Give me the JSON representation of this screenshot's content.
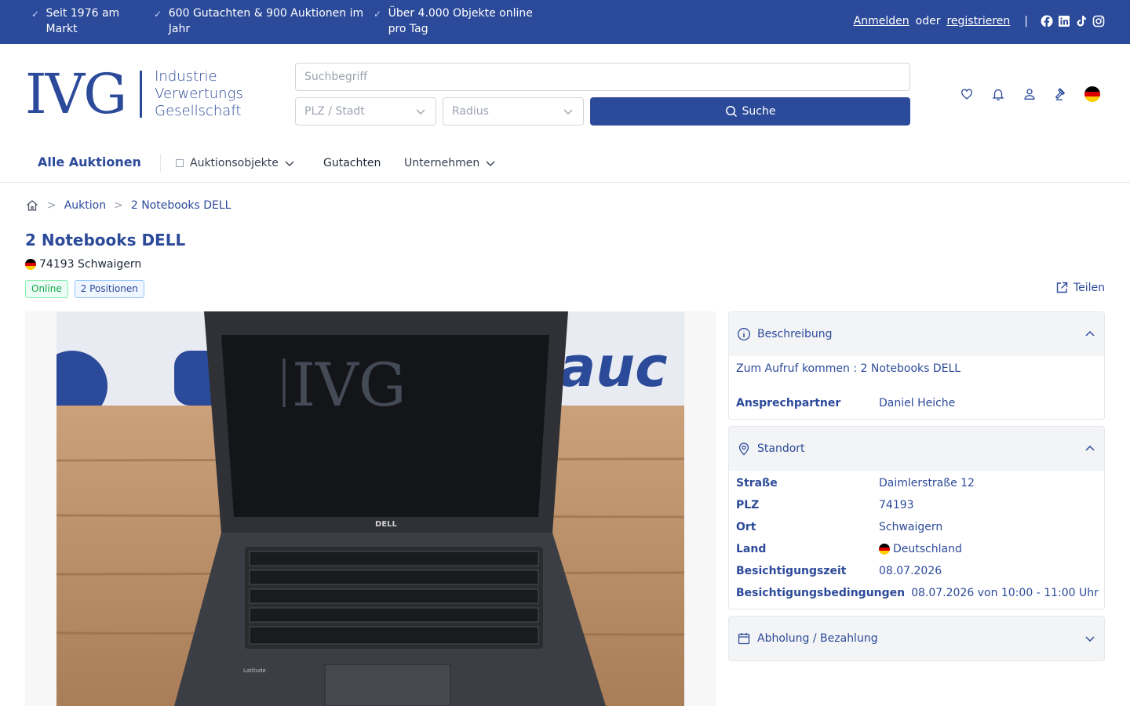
{
  "topbar": {
    "usps": [
      {
        "text": "Seit 1976 am Markt"
      },
      {
        "text": "600 Gutachten & 900 Auktionen im Jahr"
      },
      {
        "text": "Über 4.000 Objekte online pro Tag"
      }
    ],
    "login_label": "Anmelden",
    "or_label": "oder",
    "register_label": "registrieren",
    "separator": "|",
    "social_icons": [
      "facebook-icon",
      "linkedin-icon",
      "tiktok-icon",
      "instagram-icon"
    ]
  },
  "logo": {
    "mark": "IVG",
    "line1": "Industrie",
    "line2": "Verwertungs",
    "line3": "Gesellschaft"
  },
  "search": {
    "placeholder": "Suchbegriff",
    "plz_placeholder": "PLZ / Stadt",
    "radius_placeholder": "Radius",
    "button_label": "Suche"
  },
  "header_icons": [
    "heart-icon",
    "bell-icon",
    "user-icon",
    "gavel-icon",
    "german-flag-icon"
  ],
  "nav": {
    "all_auctions": "Alle Auktionen",
    "items": [
      {
        "label": "Auktionsobjekte",
        "has_dropdown": true
      },
      {
        "label": "Gutachten",
        "has_dropdown": false
      },
      {
        "label": "Unternehmen",
        "has_dropdown": true
      }
    ]
  },
  "breadcrumb": {
    "items": [
      "Auktion",
      "2 Notebooks DELL"
    ],
    "separator": ">"
  },
  "auction": {
    "title": "2 Notebooks DELL",
    "location": "74193 Schwaigern",
    "status_badge": "Online",
    "positions_badge": "2 Positionen",
    "share_label": "Teilen"
  },
  "panels": {
    "description": {
      "title": "Beschreibung",
      "text": "Zum Aufruf kommen : 2 Notebooks DELL",
      "contact_label": "Ansprechpartner",
      "contact_value": "Daniel Heiche"
    },
    "location": {
      "title": "Standort",
      "rows": [
        {
          "key": "Straße",
          "value": "Daimlerstraße 12"
        },
        {
          "key": "PLZ",
          "value": "74193"
        },
        {
          "key": "Ort",
          "value": "Schwaigern"
        },
        {
          "key": "Land",
          "value": "Deutschland"
        },
        {
          "key": "Besichtigungszeit",
          "value": "08.07.2026"
        },
        {
          "key": "Besichtigungsbedingungen",
          "value": "08.07.2026 von 10:00 - 11:00 Uhr"
        }
      ]
    },
    "pickup": {
      "title": "Abholung / Bezahlung"
    }
  },
  "photo": {
    "brand_on_screen": "DELL",
    "watermark": "IVG",
    "model": "Latitude"
  },
  "colors": {
    "brand_blue": "#2c4a9a",
    "online_green": "#16a34a"
  }
}
